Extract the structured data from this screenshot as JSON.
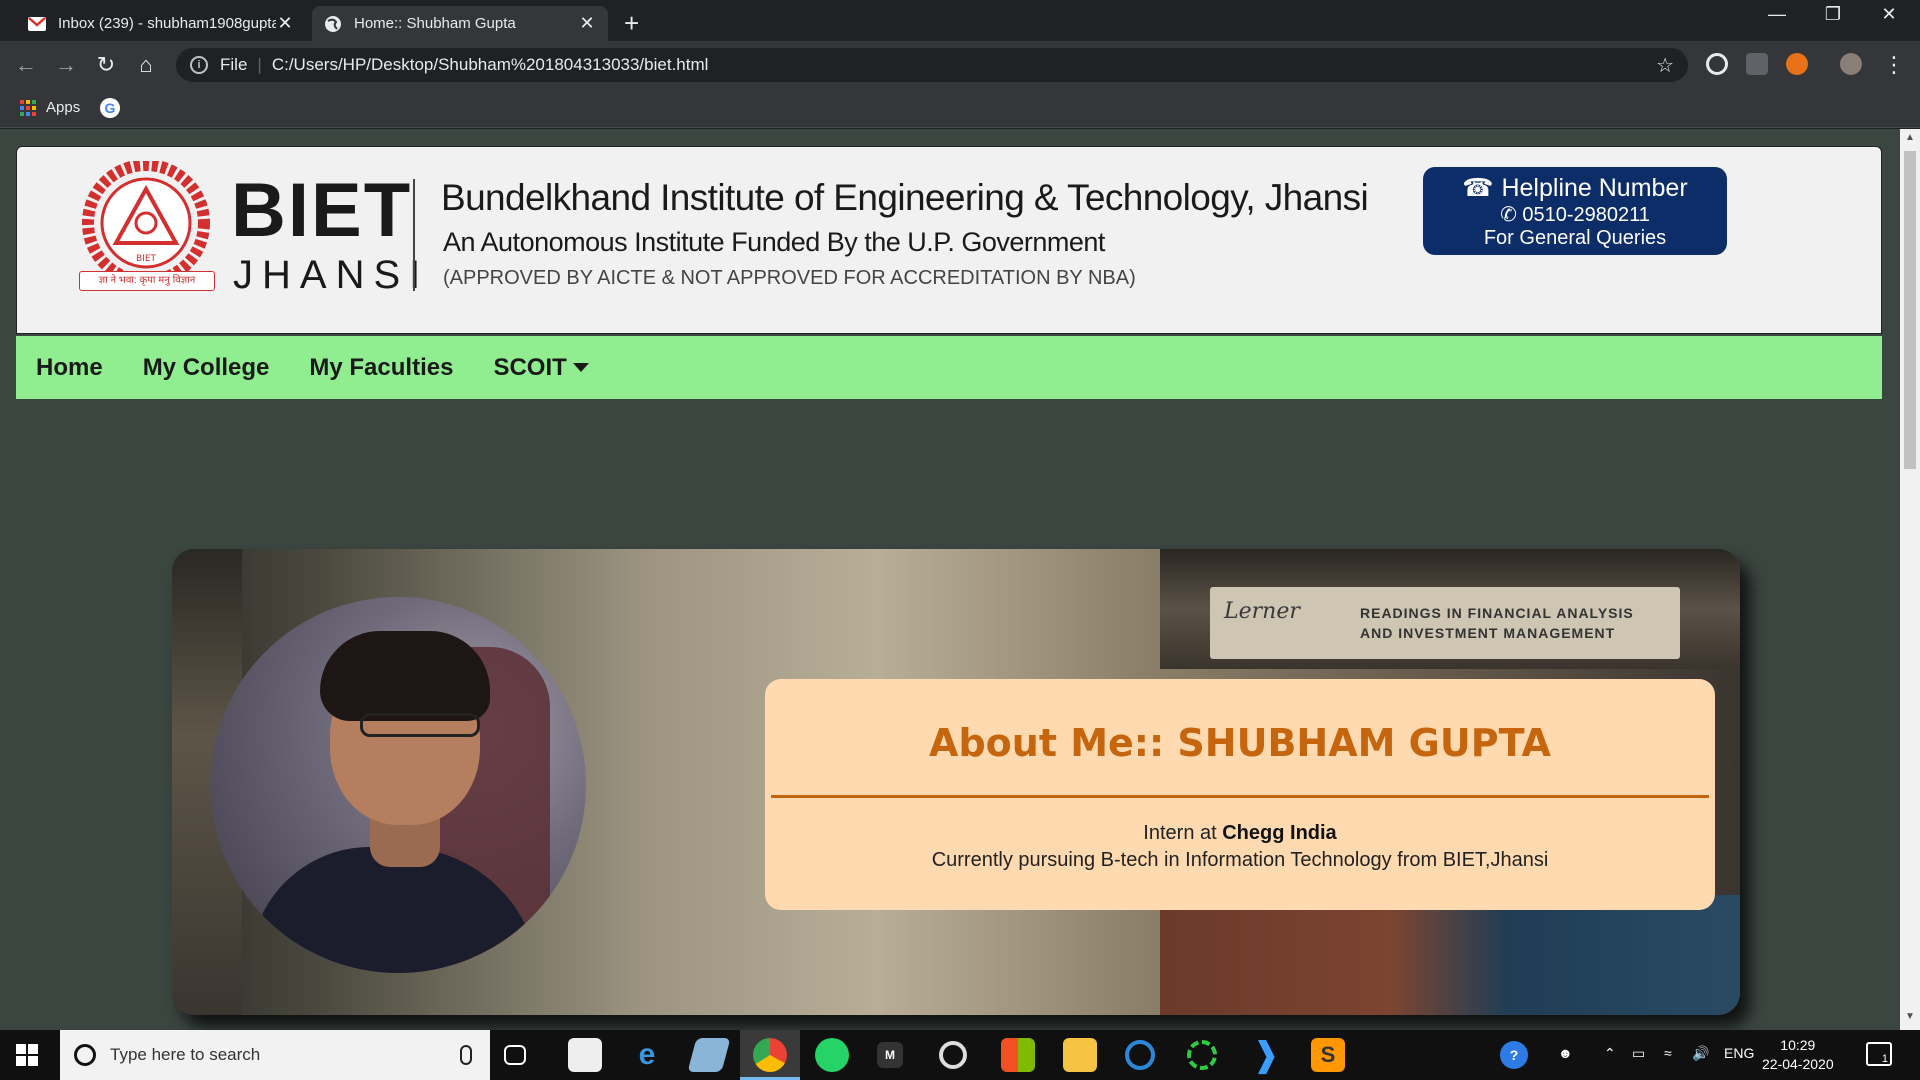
{
  "browser": {
    "tabs": [
      {
        "title": "Inbox (239) - shubham1908gupta",
        "active": false,
        "favicon": "gmail-icon"
      },
      {
        "title": "Home:: Shubham Gupta",
        "active": true,
        "favicon": "globe-icon"
      }
    ],
    "address": {
      "scheme_label": "File",
      "url": "C:/Users/HP/Desktop/Shubham%201804313033/biet.html"
    },
    "bookmarks": {
      "apps_label": "Apps",
      "google_letter": "G"
    }
  },
  "header": {
    "logo_word": "BIET",
    "logo_city": "JHANSI",
    "logo_ribbon": "ज्ञा ने भवा: कृपा मनु विज्ञान",
    "logo_seal_text": "BIET",
    "institute_name": "Bundelkhand Institute of Engineering & Technology, Jhansi",
    "institute_subtitle": "An Autonomous Institute Funded By the U.P. Government",
    "institute_approval": "(APPROVED BY AICTE  & NOT APPROVED FOR ACCREDITATION BY NBA)",
    "helpline": {
      "title": "Helpline Number",
      "number": "0510-2980211",
      "note": "For General Queries"
    }
  },
  "nav": {
    "items": [
      "Home",
      "My College",
      "My Faculties",
      "SCOIT"
    ]
  },
  "hero": {
    "book_author": "Lerner",
    "book_title_1": "READINGS IN FINANCIAL ANALYSIS",
    "book_title_2": "AND INVESTMENT MANAGEMENT",
    "about_heading": "About Me:: SHUBHAM GUPTA",
    "intern_prefix": "Intern at ",
    "intern_company": "Chegg India",
    "pursuing": "Currently pursuing B-tech in Information Technology from BIET,Jhansi"
  },
  "taskbar": {
    "search_placeholder": "Type here to search",
    "lang": "ENG",
    "time": "10:29",
    "date": "22-04-2020",
    "notification_count": "1"
  },
  "colors": {
    "nav_bg": "#90ee90",
    "helpline_bg": "#0c2d68",
    "about_bg": "#ffdab0",
    "about_accent": "#c5650e",
    "page_bg": "#3c4641"
  }
}
